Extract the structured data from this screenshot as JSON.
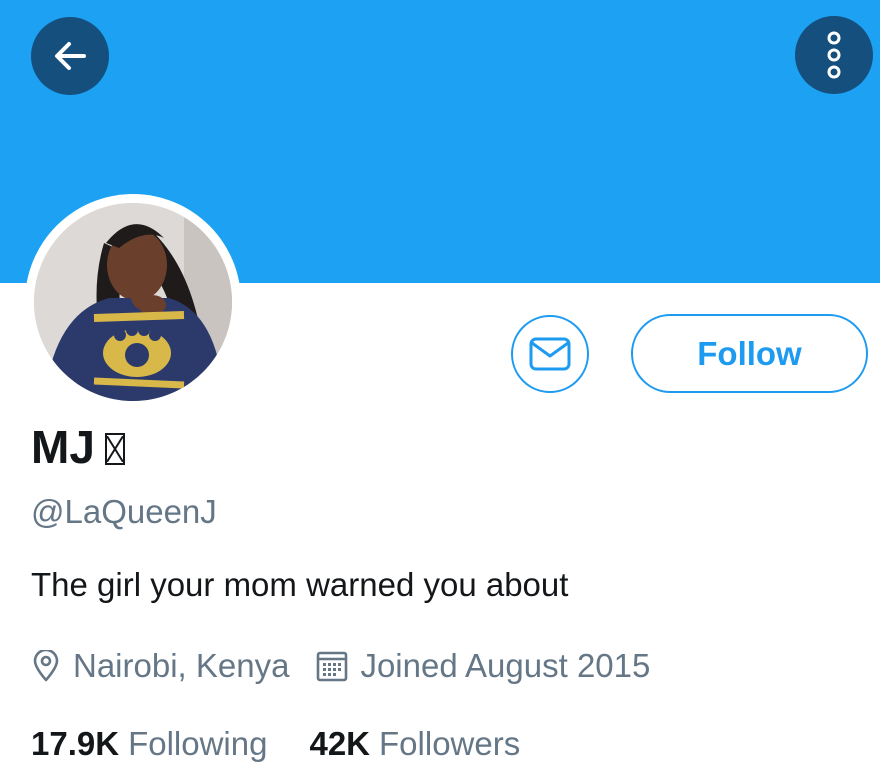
{
  "colors": {
    "banner": "#1da1f2",
    "nav_button": "#154f7d",
    "accent": "#1d9bf0",
    "primary_text": "#14171a",
    "secondary_text": "#657786"
  },
  "header": {
    "back_icon": "arrow-left-icon",
    "more_icon": "more-vertical-icon"
  },
  "profile": {
    "name": "MJ",
    "handle": "@LaQueenJ",
    "bio": "The girl your mom warned you about",
    "location": "Nairobi, Kenya",
    "joined": "Joined August 2015",
    "following_count": "17.9K",
    "following_label": "Following",
    "followers_count": "42K",
    "followers_label": "Followers"
  },
  "actions": {
    "message_icon": "envelope-icon",
    "follow_label": "Follow"
  }
}
